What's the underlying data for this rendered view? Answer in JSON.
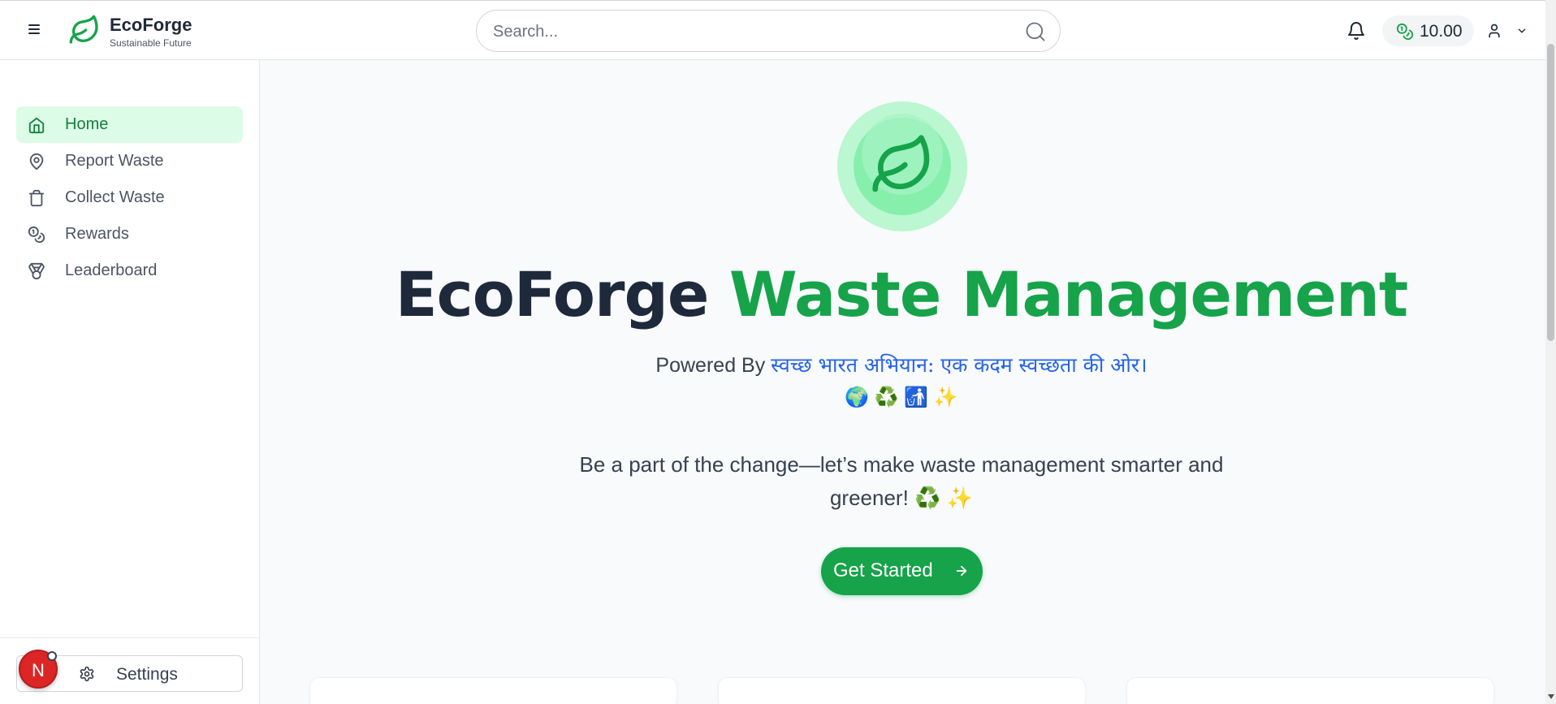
{
  "header": {
    "brand_name": "EcoForge",
    "brand_tagline": "Sustainable Future",
    "search_placeholder": "Search...",
    "balance": "10.00"
  },
  "sidebar": {
    "items": [
      {
        "label": "Home",
        "icon": "home-icon",
        "active": true
      },
      {
        "label": "Report Waste",
        "icon": "map-pin-icon",
        "active": false
      },
      {
        "label": "Collect Waste",
        "icon": "trash-icon",
        "active": false
      },
      {
        "label": "Rewards",
        "icon": "coins-icon",
        "active": false
      },
      {
        "label": "Leaderboard",
        "icon": "medal-icon",
        "active": false
      }
    ],
    "settings_label": "Settings",
    "avatar_initial": "N"
  },
  "hero": {
    "title_part1": "EcoForge",
    "title_part2": "Waste Management",
    "powered_prefix": "Powered By",
    "powered_hindi": "स्वच्छ भारत अभियान: एक कदम स्वच्छता की ओर।",
    "emojis": "🌍 ♻️ 🚮 ✨",
    "tagline": "Be a part of the change—let’s make waste management smarter and greener! ♻️ ✨",
    "cta_label": "Get Started"
  },
  "colors": {
    "accent": "#16a34a",
    "accent_light": "#dcfce7",
    "title_dark": "#1e293b",
    "link_blue": "#2563eb",
    "avatar_red": "#dc2626"
  }
}
